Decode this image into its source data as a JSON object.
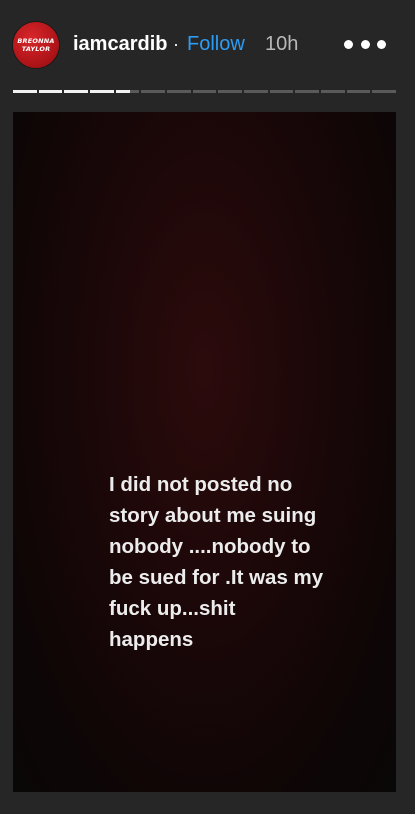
{
  "header": {
    "avatar_line1": "BREONNA",
    "avatar_line2": "TAYLOR",
    "username": "iamcardib",
    "separator": "·",
    "follow_label": "Follow",
    "time": "10h",
    "more_icon": "more-horizontal-icon"
  },
  "progress": {
    "total_segments": 15,
    "completed_segments": 4,
    "current_segment_fraction": 0.6
  },
  "story": {
    "lines": [
      "I did not posted no",
      "story about me suing",
      "nobody ....nobody to",
      "be sued for .It was my",
      "fuck up...shit",
      "happens"
    ]
  },
  "colors": {
    "background": "#262626",
    "follow": "#2d9cf5",
    "avatar": "#b11519"
  }
}
